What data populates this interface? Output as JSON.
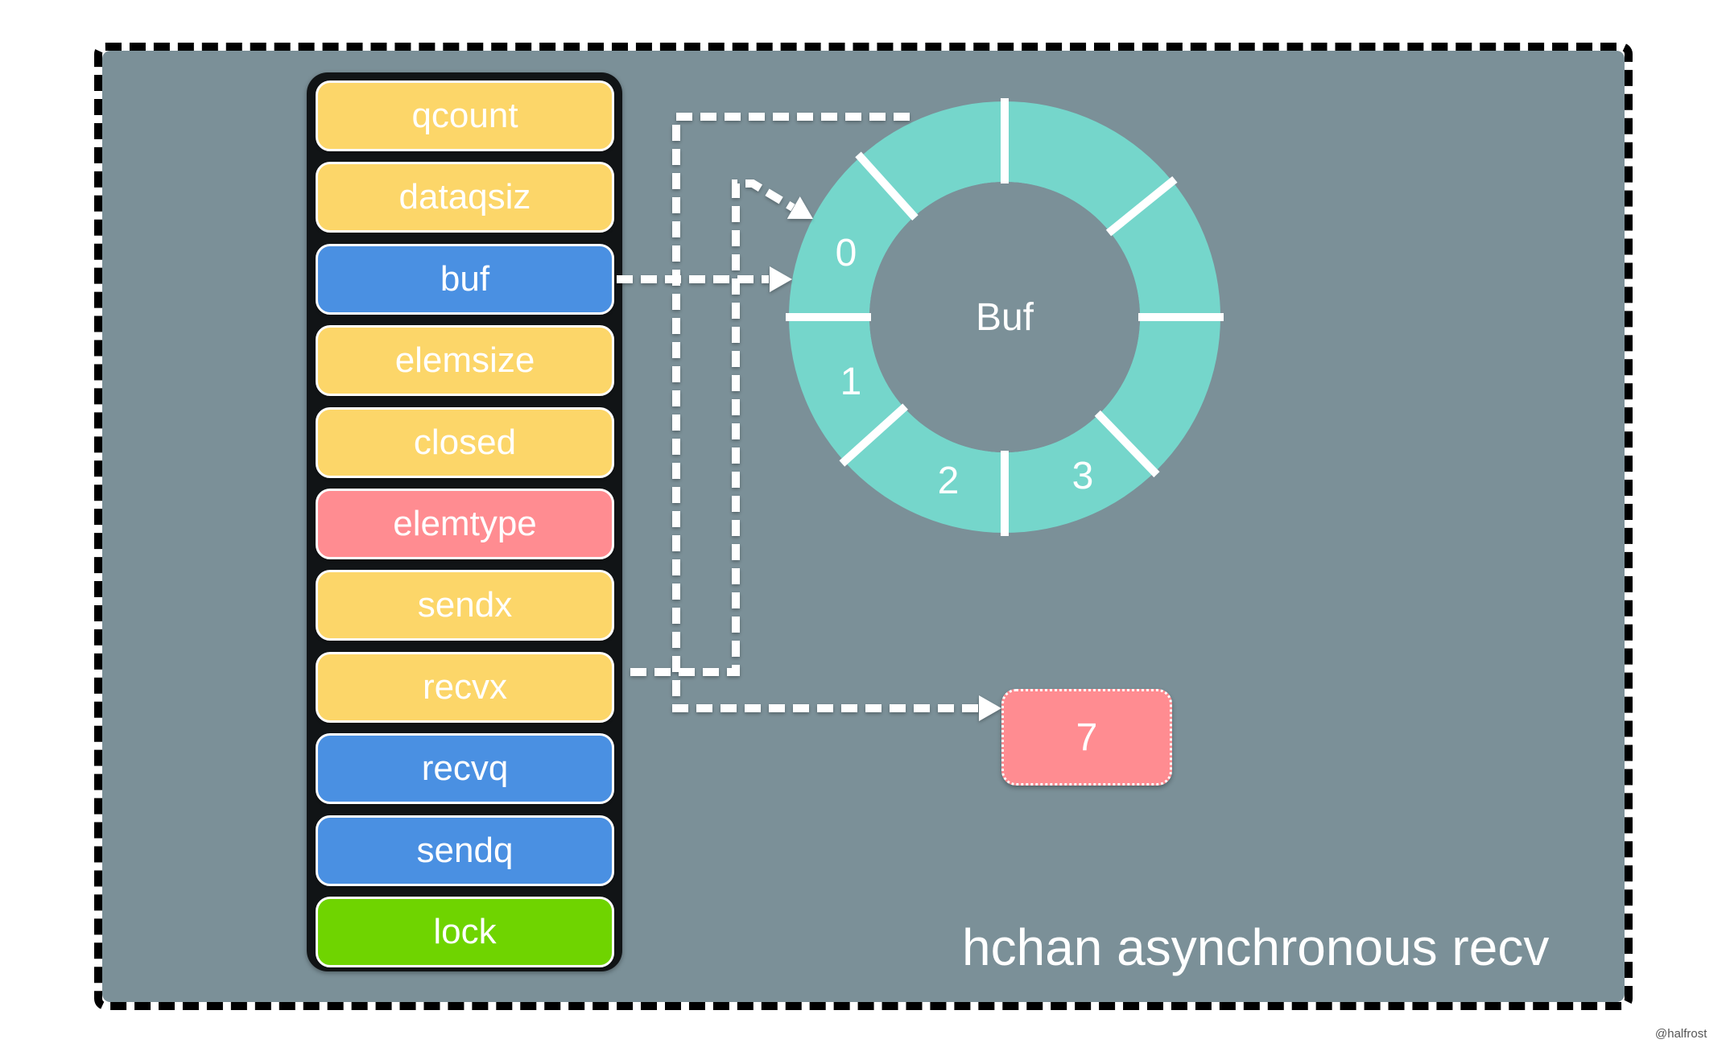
{
  "title": "hchan asynchronous recv",
  "watermark": "@halfrost",
  "colors": {
    "background_panel": "#7b9098",
    "yellow": "#fcd669",
    "blue": "#4a90e2",
    "pink": "#ff8c91",
    "green": "#6fd400",
    "ring": "#75d6cb",
    "arrow": "#ffffff"
  },
  "hchan_fields": [
    {
      "label": "qcount",
      "color": "#fcd669"
    },
    {
      "label": "dataqsiz",
      "color": "#fcd669"
    },
    {
      "label": "buf",
      "color": "#4a90e2"
    },
    {
      "label": "elemsize",
      "color": "#fcd669"
    },
    {
      "label": "closed",
      "color": "#fcd669"
    },
    {
      "label": "elemtype",
      "color": "#ff8c91"
    },
    {
      "label": "sendx",
      "color": "#fcd669"
    },
    {
      "label": "recvx",
      "color": "#fcd669"
    },
    {
      "label": "recvq",
      "color": "#4a90e2"
    },
    {
      "label": "sendq",
      "color": "#4a90e2"
    },
    {
      "label": "lock",
      "color": "#6fd400"
    }
  ],
  "ring": {
    "center_label": "Buf",
    "slot_count": 8,
    "slot_labels": [
      "0",
      "1",
      "2",
      "3"
    ]
  },
  "received_value": "7",
  "arrows": [
    {
      "from": "buf",
      "to": "ring-slot-0",
      "style": "dashed"
    },
    {
      "from": "sendx",
      "to": "ring-slot-0",
      "style": "dashed"
    },
    {
      "from": "recvx",
      "to": "received-value",
      "style": "dashed"
    }
  ]
}
